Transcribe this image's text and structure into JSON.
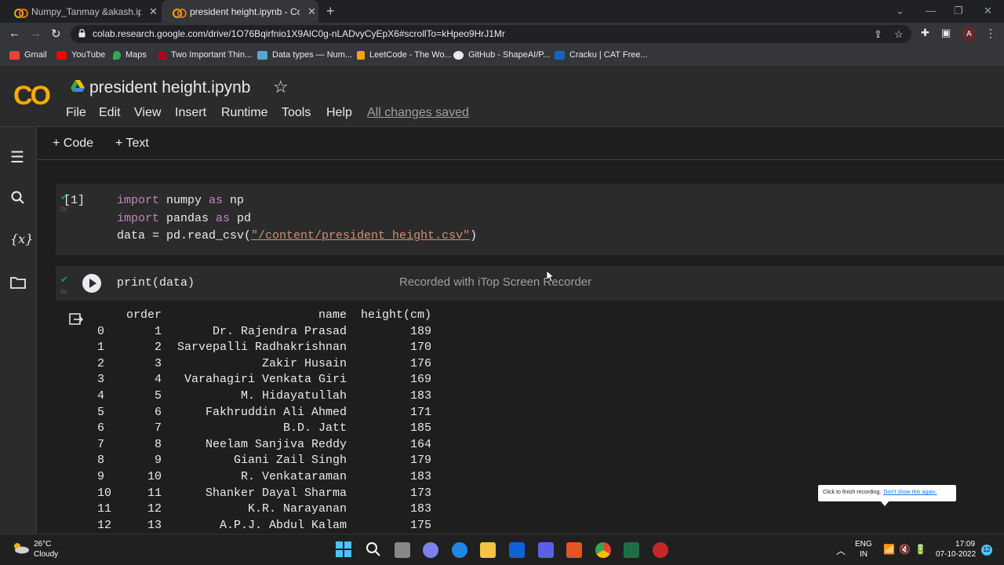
{
  "browser": {
    "tabs": [
      {
        "title": "Numpy_Tanmay &akash.ipynb - ",
        "active": false
      },
      {
        "title": "president height.ipynb - Colabo",
        "active": true
      }
    ],
    "url": "colab.research.google.com/drive/1O76Bqirfnio1X9AlC0g-nLADvyCyEpX6#scrollTo=kHpeo9HrJ1Mr",
    "profile_initial": "A",
    "bookmarks": [
      "Gmail",
      "YouTube",
      "Maps",
      "Two Important Thin...",
      "Data types — Num...",
      "LeetCode - The Wo...",
      "GitHub - ShapeAI/P...",
      "Cracku | CAT Free..."
    ]
  },
  "colab": {
    "logo_text": "CO",
    "title": "president height.ipynb",
    "menu": [
      "File",
      "Edit",
      "View",
      "Insert",
      "Runtime",
      "Tools",
      "Help"
    ],
    "save_status": "All changes saved",
    "toolbar": {
      "code": "+ Code",
      "text": "+ Text"
    },
    "rail_vars_label": "{x}"
  },
  "cells": {
    "cell1": {
      "exec_count": "[1]",
      "exec_time": "0s",
      "lines": [
        {
          "kw1": "import",
          "mid": " numpy ",
          "kw2": "as",
          "tail": " np"
        },
        {
          "kw1": "import",
          "mid": " pandas ",
          "kw2": "as",
          "tail": " pd"
        }
      ],
      "line3_prefix": "data = pd.read_csv(",
      "line3_string": "\"/content/president_height.csv\"",
      "line3_suffix": ")"
    },
    "cell2": {
      "exec_time": "0s",
      "code": "print(data)",
      "watermark": "Recorded with iTop Screen Recorder"
    }
  },
  "output": {
    "headers": [
      "order",
      "name",
      "height(cm)"
    ],
    "rows": [
      [
        "0",
        "1",
        "Dr. Rajendra Prasad",
        "189"
      ],
      [
        "1",
        "2",
        "Sarvepalli Radhakrishnan",
        "170"
      ],
      [
        "2",
        "3",
        "Zakir Husain",
        "176"
      ],
      [
        "3",
        "4",
        "Varahagiri Venkata Giri",
        "169"
      ],
      [
        "4",
        "5",
        "M. Hidayatullah",
        "183"
      ],
      [
        "5",
        "6",
        "Fakhruddin Ali Ahmed",
        "171"
      ],
      [
        "6",
        "7",
        "B.D. Jatt",
        "185"
      ],
      [
        "7",
        "8",
        "Neelam Sanjiva Reddy",
        "164"
      ],
      [
        "8",
        "9",
        "Giani Zail Singh",
        "179"
      ],
      [
        "9",
        "10",
        "R. Venkataraman",
        "183"
      ],
      [
        "10",
        "11",
        "Shanker Dayal Sharma",
        "173"
      ],
      [
        "11",
        "12",
        "K.R. Narayanan",
        "183"
      ],
      [
        "12",
        "13",
        "A.P.J. Abdul Kalam",
        "175"
      ]
    ]
  },
  "recorder_tip": {
    "text": "Click to finish recording.",
    "link": "Don't show this again."
  },
  "taskbar": {
    "weather_temp": "26°C",
    "weather_desc": "Cloudy",
    "lang_top": "ENG",
    "lang_bottom": "IN",
    "time": "17:09",
    "date": "07-10-2022",
    "notif_count": "12"
  },
  "colors": {
    "accent_orange": "#f9ab00",
    "check_green": "#0f9d58",
    "string_red": "#ce9178",
    "keyword_purple": "#c586c0"
  }
}
